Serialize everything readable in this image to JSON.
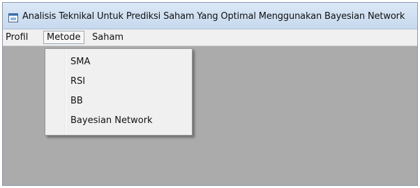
{
  "window": {
    "title": "Analisis Teknikal Untuk Prediksi Saham Yang Optimal Menggunakan Bayesian Network",
    "icon": "app-window-icon"
  },
  "menubar": {
    "items": [
      {
        "label": "Profil"
      },
      {
        "label": "Metode",
        "active": true
      },
      {
        "label": "Saham"
      }
    ]
  },
  "dropdown": {
    "items": [
      {
        "label": "SMA"
      },
      {
        "label": "RSI"
      },
      {
        "label": "BB"
      },
      {
        "label": "Bayesian Network"
      }
    ]
  },
  "colors": {
    "client_background": "#ababab",
    "menu_background": "#f0f0f0",
    "titlebar": "#c7d9ee"
  }
}
